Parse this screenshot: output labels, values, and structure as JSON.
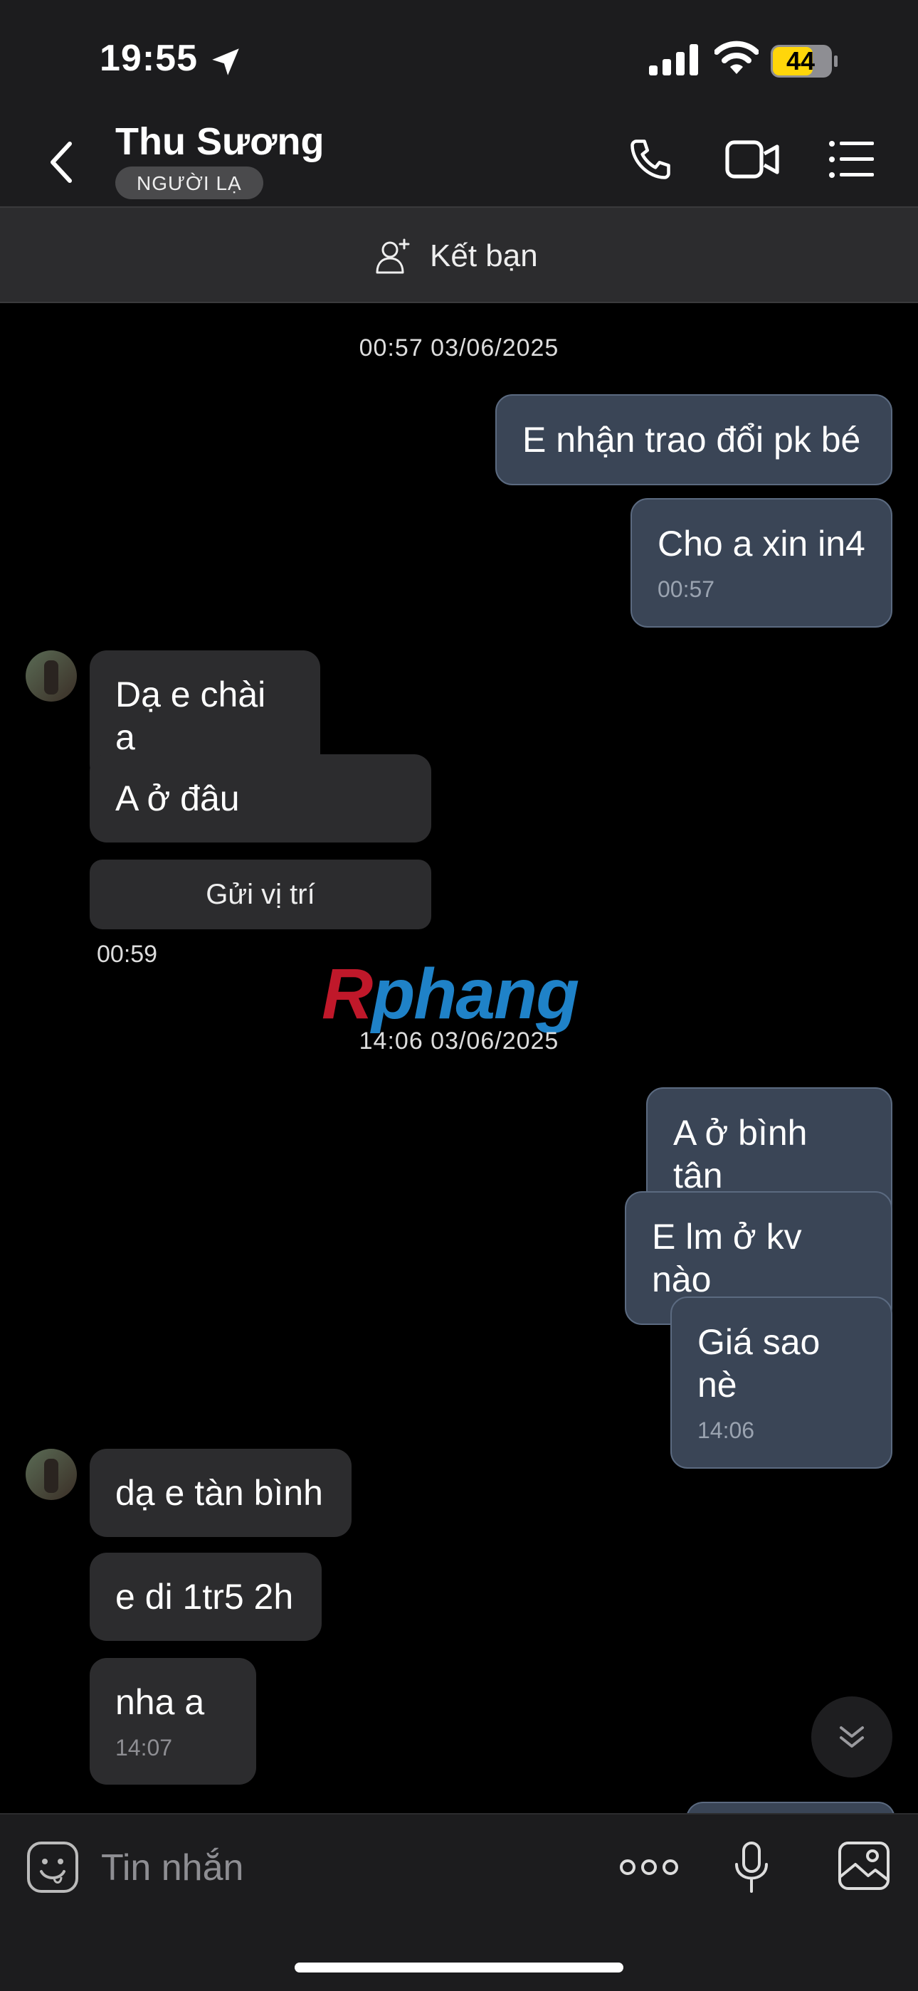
{
  "status_bar": {
    "time": "19:55",
    "battery": "44"
  },
  "header": {
    "name": "Thu Sương",
    "badge": "NGƯỜI LẠ"
  },
  "friend_bar": {
    "label": "Kết bạn"
  },
  "chat": {
    "stamp1": "00:57 03/06/2025",
    "m1": "E nhận trao đổi pk bé",
    "m2": "Cho a xin in4",
    "m2_time": "00:57",
    "r1": "Dạ e chài a",
    "r2": "A ở đâu",
    "send_location": "Gửi vị trí",
    "time_0059": "00:59",
    "stamp2": "14:06 03/06/2025",
    "m3": "A ở bình tân",
    "m4": "E lm ở kv nào",
    "m5": "Giá sao nè",
    "m5_time": "14:06",
    "r3": "dạ e tàn bình",
    "r4": "e di 1tr5 2h",
    "r5": "nha a",
    "r5_time": "14:07"
  },
  "watermark": {
    "first": "R",
    "rest": "phang"
  },
  "composer": {
    "placeholder": "Tin nhắn"
  },
  "colors": {
    "outgoing_bubble": "#3a4556",
    "incoming_bubble": "#2c2c2e",
    "battery": "#ffd60a"
  },
  "icons": [
    "location-arrow-icon",
    "signal-icon",
    "wifi-icon",
    "battery-icon",
    "back-chevron-icon",
    "phone-icon",
    "video-camera-icon",
    "list-menu-icon",
    "add-friend-icon",
    "double-chevron-down-icon",
    "emoji-icon",
    "more-dots-icon",
    "microphone-icon",
    "gallery-icon"
  ]
}
